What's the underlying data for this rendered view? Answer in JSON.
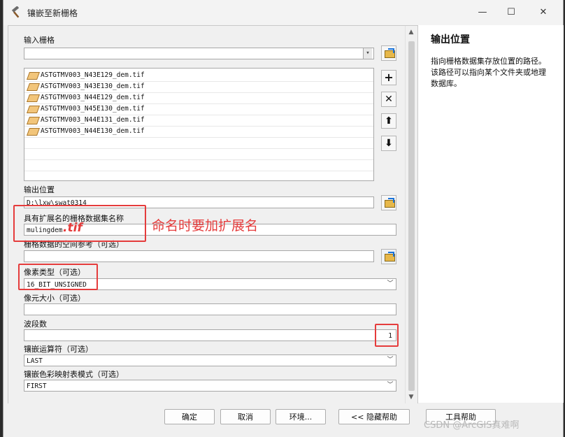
{
  "window": {
    "title": "镶嵌至新栅格",
    "minimize": "—",
    "maximize": "☐",
    "close": "✕"
  },
  "form": {
    "input_rasters_label": "输入栅格",
    "input_rasters_value": "",
    "rasters": [
      "ASTGTMV003_N43E129_dem.tif",
      "ASTGTMV003_N43E130_dem.tif",
      "ASTGTMV003_N44E129_dem.tif",
      "ASTGTMV003_N45E130_dem.tif",
      "ASTGTMV003_N44E131_dem.tif",
      "ASTGTMV003_N44E130_dem.tif"
    ],
    "output_location_label": "输出位置",
    "output_location_value": "D:\\lxw\\swat0314",
    "dataset_name_label": "具有扩展名的栅格数据集名称",
    "dataset_name_value": "mulingdem",
    "handwritten_ext": ".tif",
    "spatial_ref_label": "栅格数据的空间参考（可选）",
    "spatial_ref_value": "",
    "pixel_type_label": "像素类型（可选）",
    "pixel_type_value": "16_BIT_UNSIGNED",
    "cellsize_label": "像元大小（可选）",
    "cellsize_value": "",
    "bands_label": "波段数",
    "bands_value": "1",
    "mosaic_operator_label": "镶嵌运算符（可选）",
    "mosaic_operator_value": "LAST",
    "colormap_mode_label": "镶嵌色彩映射表模式（可选）",
    "colormap_mode_value": "FIRST",
    "annotation": "命名时要加扩展名"
  },
  "list_buttons": {
    "add": "+",
    "remove": "✕",
    "up": "⬆",
    "down": "⬇"
  },
  "help": {
    "title": "输出位置",
    "body": "指向栅格数据集存放位置的路径。该路径可以指向某个文件夹或地理数据库。"
  },
  "buttons": {
    "ok": "确定",
    "cancel": "取消",
    "env": "环境...",
    "hide_help": "<< 隐藏帮助",
    "tool_help": "工具帮助"
  },
  "watermark": "CSDN @ArcGIS真难啊",
  "colors": {
    "annotation_red": "#e53c3c"
  }
}
